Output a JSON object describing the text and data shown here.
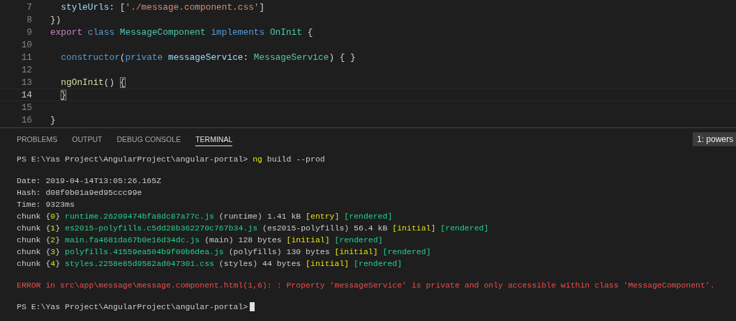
{
  "editor": {
    "lines": [
      {
        "number": "7",
        "current": false,
        "tokens": [
          {
            "text": "  styleUrls",
            "kind": "property"
          },
          {
            "text": ": [",
            "kind": "plain"
          },
          {
            "text": "'./message.component.css'",
            "kind": "string"
          },
          {
            "text": "]",
            "kind": "plain"
          }
        ]
      },
      {
        "number": "8",
        "current": false,
        "tokens": [
          {
            "text": "})",
            "kind": "plain"
          }
        ]
      },
      {
        "number": "9",
        "current": false,
        "tokens": [
          {
            "text": "export",
            "kind": "control"
          },
          {
            "text": " class",
            "kind": "keyword"
          },
          {
            "text": " MessageComponent",
            "kind": "type"
          },
          {
            "text": " implements",
            "kind": "keyword"
          },
          {
            "text": " OnInit",
            "kind": "type"
          },
          {
            "text": " {",
            "kind": "plain"
          }
        ]
      },
      {
        "number": "10",
        "current": false
      },
      {
        "number": "11",
        "current": false,
        "tokens": [
          {
            "text": "  constructor",
            "kind": "keyword"
          },
          {
            "text": "(",
            "kind": "plain"
          },
          {
            "text": "private",
            "kind": "keyword"
          },
          {
            "text": " messageService",
            "kind": "property"
          },
          {
            "text": ": ",
            "kind": "plain"
          },
          {
            "text": "MessageService",
            "kind": "type"
          },
          {
            "text": ") { }",
            "kind": "plain"
          }
        ]
      },
      {
        "number": "12",
        "current": false
      },
      {
        "number": "13",
        "current": false,
        "tokens": [
          {
            "text": "  ngOnInit",
            "kind": "function"
          },
          {
            "text": "() ",
            "kind": "plain"
          },
          {
            "text": "{",
            "kind": "bracket-match"
          }
        ]
      },
      {
        "number": "14",
        "current": true,
        "tokens": [
          {
            "text": "  }",
            "kind": "bracket-match"
          }
        ]
      },
      {
        "number": "15",
        "current": false
      },
      {
        "number": "16",
        "current": false,
        "tokens": [
          {
            "text": "}",
            "kind": "plain"
          }
        ]
      }
    ]
  },
  "panel": {
    "tabs": [
      {
        "label": "PROBLEMS",
        "selected": false
      },
      {
        "label": "OUTPUT",
        "selected": false
      },
      {
        "label": "DEBUG CONSOLE",
        "selected": false
      },
      {
        "label": "TERMINAL",
        "selected": true
      }
    ],
    "terminal_picker": "1: powers",
    "lines": [
      {
        "gap_before": false,
        "cursor": false,
        "segments": [
          {
            "text": "PS E:\\Yas Project\\AngularProject\\angular-portal> ",
            "kind": "plain"
          },
          {
            "text": "ng",
            "kind": "yellow"
          },
          {
            "text": " build --prod",
            "kind": "plain"
          }
        ]
      },
      {
        "gap_before": true,
        "cursor": false,
        "segments": [
          {
            "text": "Date: 2019-04-14T13:05:26.165Z",
            "kind": "plain"
          }
        ]
      },
      {
        "gap_before": false,
        "cursor": false,
        "segments": [
          {
            "text": "Hash: d08f0b01a9ed95ccc99e",
            "kind": "plain"
          }
        ]
      },
      {
        "gap_before": false,
        "cursor": false,
        "segments": [
          {
            "text": "Time: 9323ms",
            "kind": "plain"
          }
        ]
      },
      {
        "gap_before": false,
        "cursor": false,
        "segments": [
          {
            "text": "chunk {",
            "kind": "plain"
          },
          {
            "text": "0",
            "kind": "yellow"
          },
          {
            "text": "} ",
            "kind": "plain"
          },
          {
            "text": "runtime.26209474bfa8dc87a77c.js",
            "kind": "green"
          },
          {
            "text": " (runtime) 1.41 kB ",
            "kind": "plain"
          },
          {
            "text": "[entry]",
            "kind": "yellow"
          },
          {
            "text": " [rendered]",
            "kind": "green"
          }
        ]
      },
      {
        "gap_before": false,
        "cursor": false,
        "segments": [
          {
            "text": "chunk {",
            "kind": "plain"
          },
          {
            "text": "1",
            "kind": "yellow"
          },
          {
            "text": "} ",
            "kind": "plain"
          },
          {
            "text": "es2015-polyfills.c5dd28b362270c767b34.js",
            "kind": "green"
          },
          {
            "text": " (es2015-polyfills) 56.4 kB ",
            "kind": "plain"
          },
          {
            "text": "[initial]",
            "kind": "yellow"
          },
          {
            "text": " [rendered]",
            "kind": "green"
          }
        ]
      },
      {
        "gap_before": false,
        "cursor": false,
        "segments": [
          {
            "text": "chunk {",
            "kind": "plain"
          },
          {
            "text": "2",
            "kind": "yellow"
          },
          {
            "text": "} ",
            "kind": "plain"
          },
          {
            "text": "main.fa4681da67b0e16d34dc.js",
            "kind": "green"
          },
          {
            "text": " (main) 128 bytes ",
            "kind": "plain"
          },
          {
            "text": "[initial]",
            "kind": "yellow"
          },
          {
            "text": " [rendered]",
            "kind": "green"
          }
        ]
      },
      {
        "gap_before": false,
        "cursor": false,
        "segments": [
          {
            "text": "chunk {",
            "kind": "plain"
          },
          {
            "text": "3",
            "kind": "yellow"
          },
          {
            "text": "} ",
            "kind": "plain"
          },
          {
            "text": "polyfills.41559ea504b9f00b6dea.js",
            "kind": "green"
          },
          {
            "text": " (polyfills) 130 bytes ",
            "kind": "plain"
          },
          {
            "text": "[initial]",
            "kind": "yellow"
          },
          {
            "text": " [rendered]",
            "kind": "green"
          }
        ]
      },
      {
        "gap_before": false,
        "cursor": false,
        "segments": [
          {
            "text": "chunk {",
            "kind": "plain"
          },
          {
            "text": "4",
            "kind": "yellow"
          },
          {
            "text": "} ",
            "kind": "plain"
          },
          {
            "text": "styles.2258e85d9582ad047301.css",
            "kind": "green"
          },
          {
            "text": " (styles) 44 bytes ",
            "kind": "plain"
          },
          {
            "text": "[initial]",
            "kind": "yellow"
          },
          {
            "text": " [rendered]",
            "kind": "green"
          }
        ]
      },
      {
        "gap_before": true,
        "cursor": false,
        "segments": [
          {
            "text": "ERROR in src\\app\\message\\message.component.html(1,6): : Property 'messageService' is private and only accessible within class 'MessageComponent'.",
            "kind": "red"
          }
        ]
      },
      {
        "gap_before": true,
        "cursor": true,
        "segments": [
          {
            "text": "PS E:\\Yas Project\\AngularProject\\angular-portal>",
            "kind": "plain"
          }
        ]
      }
    ]
  }
}
